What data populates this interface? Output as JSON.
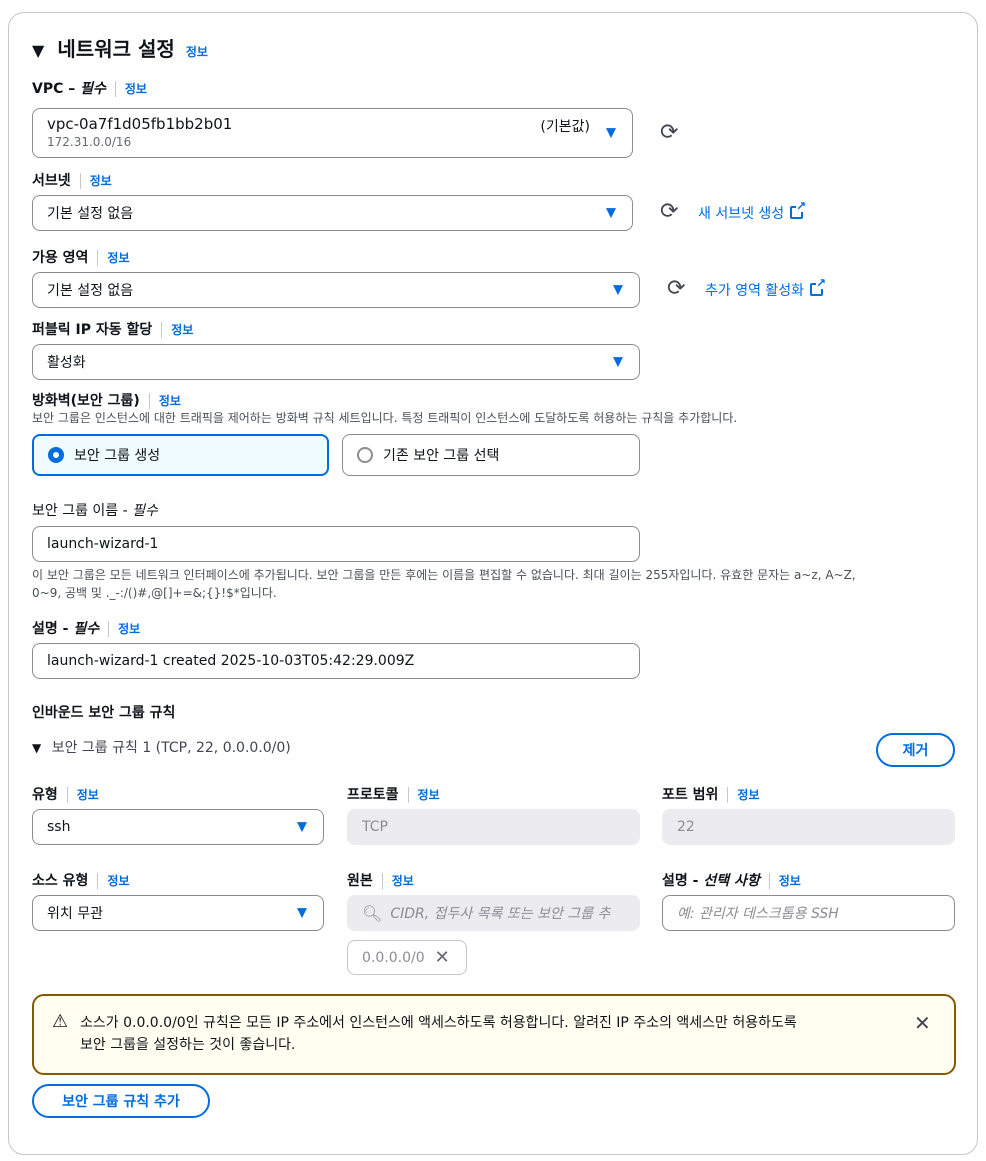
{
  "header": {
    "title": "네트워크 설정",
    "info": "정보"
  },
  "vpc": {
    "label": "VPC – ",
    "required": "필수",
    "info": "정보",
    "value": "vpc-0a7f1d05fb1bb2b01",
    "cidr": "172.31.0.0/16",
    "default_tag": "(기본값)"
  },
  "subnet": {
    "label": "서브넷",
    "info": "정보",
    "value": "기본 설정 없음",
    "create_link": "새 서브넷 생성"
  },
  "az": {
    "label": "가용 영역",
    "info": "정보",
    "value": "기본 설정 없음",
    "enable_link": "추가 영역 활성화"
  },
  "public_ip": {
    "label": "퍼블릭 IP 자동 할당",
    "info": "정보",
    "value": "활성화"
  },
  "firewall": {
    "label": "방화벽(보안 그룹)",
    "info": "정보",
    "description": "보안 그룹은 인스턴스에 대한 트래픽을 제어하는 방화벽 규칙 세트입니다. 특정 트래픽이 인스턴스에 도달하도록 허용하는 규칙을 추가합니다.",
    "option_create": "보안 그룹 생성",
    "option_existing": "기존 보안 그룹 선택"
  },
  "sg_name": {
    "label": "보안 그룹 이름 - ",
    "required": "필수",
    "value": "launch-wizard-1",
    "hint_line1": "이 보안 그룹은 모든 네트워크 인터페이스에 추가됩니다. 보안 그룹을 만든 후에는 이름을 편집할 수 없습니다. 최대 길이는 255자입니다. 유효한 문자는 a~z, A~Z,",
    "hint_line2": "0~9, 공백 및 ._-:/()#,@[]+=&;{}!$*입니다."
  },
  "description_field": {
    "label": "설명 - ",
    "required": "필수",
    "info": "정보",
    "value": "launch-wizard-1 created 2025-10-03T05:42:29.009Z"
  },
  "inbound": {
    "title": "인바운드 보안 그룹 규칙",
    "rule_title": "보안 그룹 규칙 1 (TCP, 22, 0.0.0.0/0)",
    "remove_button": "제거",
    "type_label": "유형",
    "type_value": "ssh",
    "protocol_label": "프로토콜",
    "protocol_value": "TCP",
    "port_label": "포트 범위",
    "port_value": "22",
    "source_type_label": "소스 유형",
    "source_type_value": "위치 무관",
    "source_label": "원본",
    "source_placeholder": "CIDR, 접두사 목록 또는 보안 그룹 추",
    "source_token": "0.0.0.0/0",
    "desc_label": "설명 - ",
    "desc_optional": "선택 사항",
    "desc_placeholder": "예: 관리자 데스크톱용 SSH",
    "info": "정보"
  },
  "warning": {
    "line1": "소스가 0.0.0.0/0인 규칙은 모든 IP 주소에서 인스턴스에 액세스하도록 허용합니다. 알려진 IP 주소의 액세스만 허용하도록",
    "line2": "보안 그룹을 설정하는 것이 좋습니다."
  },
  "add_rule_button": "보안 그룹 규칙 추가",
  "colors": {
    "link": "#006ce0",
    "warning_border": "#855900",
    "warning_bg": "#fffef0"
  }
}
